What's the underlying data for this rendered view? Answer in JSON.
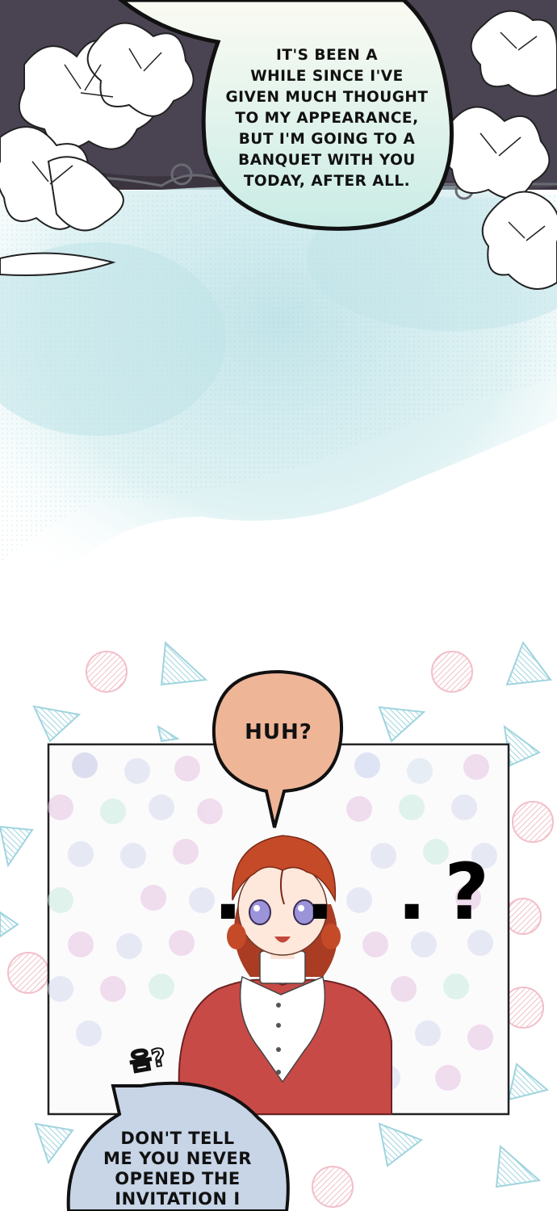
{
  "panel_top": {
    "speech_bubble": {
      "lines": [
        "It's been a",
        "while since I've",
        "given much thought",
        "to my appearance,",
        "but I'm going to a",
        "banquet with you",
        "today, after all."
      ]
    }
  },
  "panel_bottom": {
    "huh_bubble": {
      "text": "HUH?"
    },
    "ellipsis_mark": {
      "text": ". . .?"
    },
    "korean_sfx": {
      "text": "음?"
    },
    "speech_bubble": {
      "lines": [
        "DON'T TELL",
        "ME YOU NEVER",
        "OPENED THE",
        "INVITATION I"
      ]
    }
  },
  "colors": {
    "lily_background": "#3b3540",
    "watercolor": "#bfe3e8",
    "huh_bubble": "#efb597",
    "speech_bubble_gradient_top": "#fbfbf3",
    "speech_bubble_gradient_bottom": "#c9ece5",
    "bottom_bubble": "#c7d5e7",
    "character_hair": "#c54a28",
    "character_shawl": "#c84a47",
    "character_eyes": "#9c94d9"
  }
}
